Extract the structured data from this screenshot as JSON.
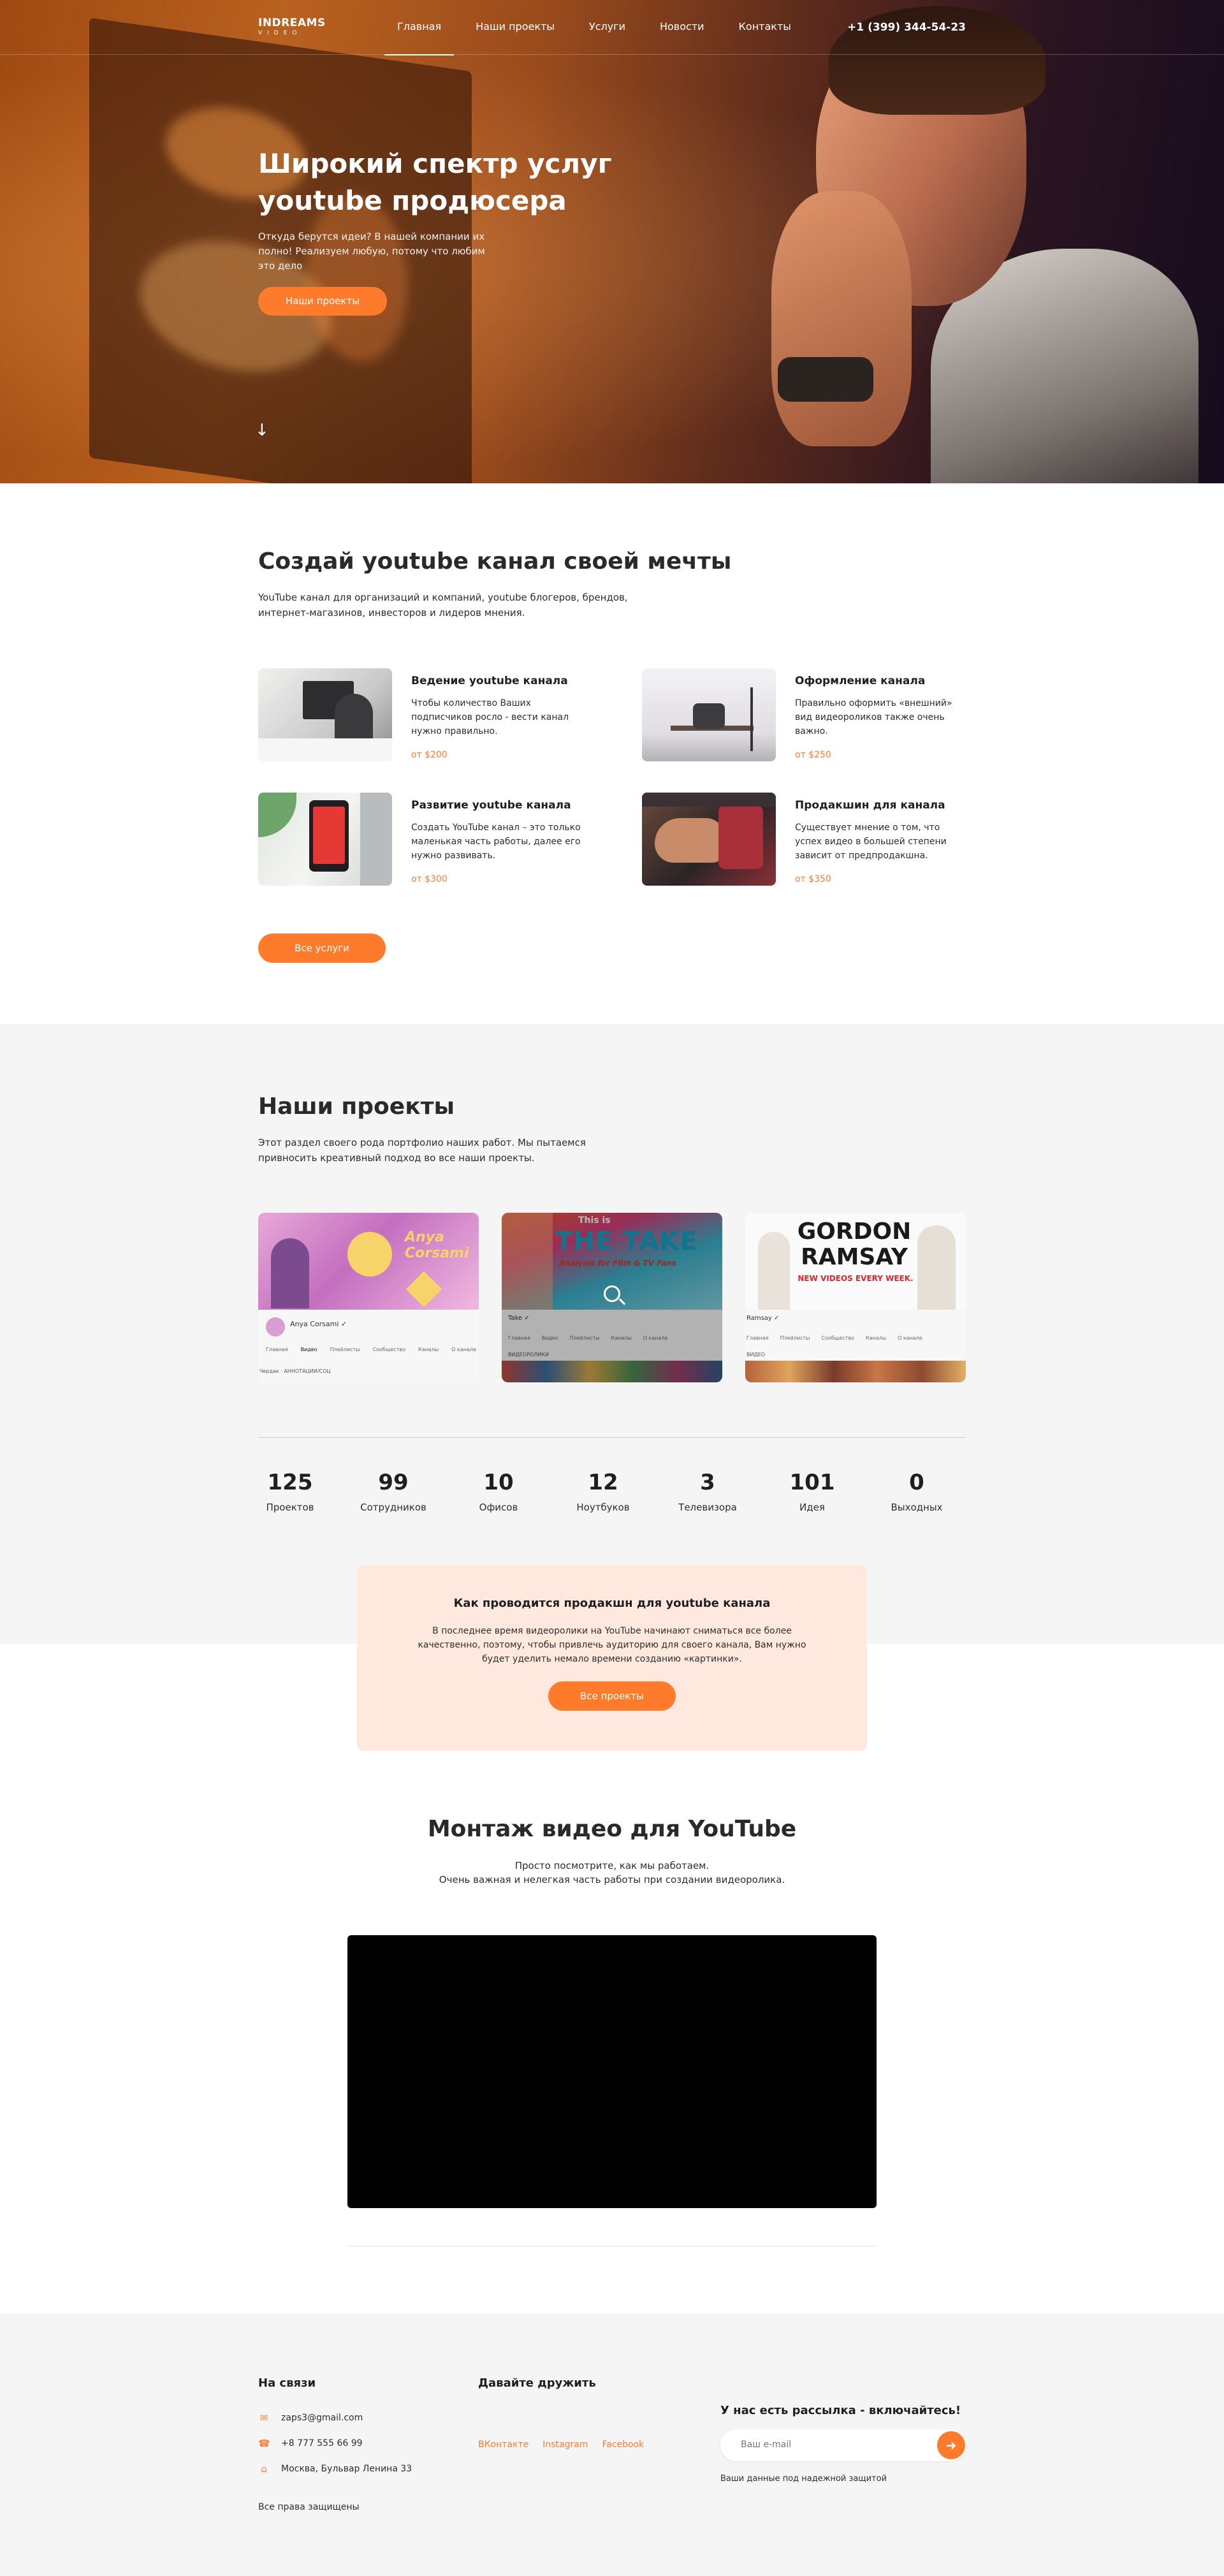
{
  "header": {
    "logo_main": "INDREAMS",
    "logo_sub": "VIDEO",
    "nav": [
      "Главная",
      "Наши проекты",
      "Услуги",
      "Новости",
      "Контакты"
    ],
    "phone": "+1 (399) 344-54-23"
  },
  "hero": {
    "title": "Широкий спектр услуг youtube продюсера",
    "text": "Откуда берутся идеи? В нашей компании их полно! Реализуем любую, потому что любим это дело",
    "button": "Наши проекты",
    "scroll_icon": "arrow-down-icon"
  },
  "services": {
    "title": "Создай youtube канал своей мечты",
    "text": "YouTube канал для организаций и компаний, youtube блогеров, брендов, интернет-магазинов, инвесторов и лидеров мнения.",
    "items": [
      {
        "title": "Ведение youtube канала",
        "desc": "Чтобы количество Ваших подписчиков росло - вести канал нужно правильно.",
        "price": "от $200"
      },
      {
        "title": "Оформление канала",
        "desc": "Правильно оформить «внешний» вид видеороликов также очень важно.",
        "price": "от $250"
      },
      {
        "title": "Развитие youtube канала",
        "desc": "Создать YouTube канал – это только маленькая часть работы, далее его нужно развивать.",
        "price": "от $300"
      },
      {
        "title": "Продакшин для канала",
        "desc": "Существует мнение о том, что успех видео в большей степени зависит от предпродакшна.",
        "price": "от $350"
      }
    ],
    "button": "Все услуги"
  },
  "projects": {
    "title": "Наши проекты",
    "text": "Этот раздел своего рода портфолио наших работ. Мы пытаемся привносить креативный подход во все наши проекты.",
    "cards": [
      {
        "banner_text": "Anya Corsami",
        "channel": "Anya Corsami ✓",
        "tabs": [
          "Главная",
          "Видео",
          "Плейлисты",
          "Сообщество",
          "Каналы",
          "О канале"
        ],
        "footer": "Чердак · АННОТАЦИИ/СОЦ"
      },
      {
        "banner_top": "This is",
        "banner_main": "THE TAKE",
        "banner_sub": "Analysis for Film & TV Fans",
        "channel": "Take ✓",
        "tabs": [
          "Главная",
          "Видео",
          "Плейлисты",
          "Каналы",
          "О канале"
        ],
        "footer": "ВИДЕОРОЛИКИ"
      },
      {
        "banner_main": "GORDON RAMSAY",
        "banner_sub": "NEW VIDEOS EVERY WEEK.",
        "channel": "Ramsay ✓",
        "tabs": [
          "Главная",
          "Плейлисты",
          "Сообщество",
          "Каналы",
          "О канале"
        ],
        "footer": "ВИДЕО"
      }
    ]
  },
  "stats": [
    {
      "num": "125",
      "label": "Проектов"
    },
    {
      "num": "99",
      "label": "Сотрудников"
    },
    {
      "num": "10",
      "label": "Офисов"
    },
    {
      "num": "12",
      "label": "Ноутбуков"
    },
    {
      "num": "3",
      "label": "Телевизора"
    },
    {
      "num": "101",
      "label": "Идея"
    },
    {
      "num": "0",
      "label": "Выходных"
    }
  ],
  "cta": {
    "title": "Как проводится продакшн для youtube канала",
    "text": "В последнее время видеоролики на YouTube начинают сниматься все более качественно, поэтому, чтобы привлечь аудиторию для своего канала, Вам нужно будет уделить немало времени созданию «картинки».",
    "button": "Все проекты"
  },
  "video_section": {
    "title": "Монтаж видео для YouTube",
    "line1": "Просто посмотрите, как мы работаем.",
    "line2": "Очень важная и нелегкая часть работы при создании видеоролика."
  },
  "footer": {
    "contacts_title": "На связи",
    "email": "zaps3@gmail.com",
    "phone": "+8 777 555 66 99",
    "address": "Москва, Бульвар Ленина 33",
    "copyright": "Все права защищены",
    "social_title": "Давайте дружить",
    "social": [
      "ВКонтакте",
      "Instagram",
      "Facebook"
    ],
    "subscribe_title": "У нас есть рассылка - включайтесь!",
    "subscribe_placeholder": "Ваш e-mail",
    "subscribe_note": "Ваши данные под надежной защитой"
  },
  "colors": {
    "accent": "#ff7b2c",
    "light_bg": "#f5f5f6",
    "cta_bg": "#ffe8dd"
  }
}
